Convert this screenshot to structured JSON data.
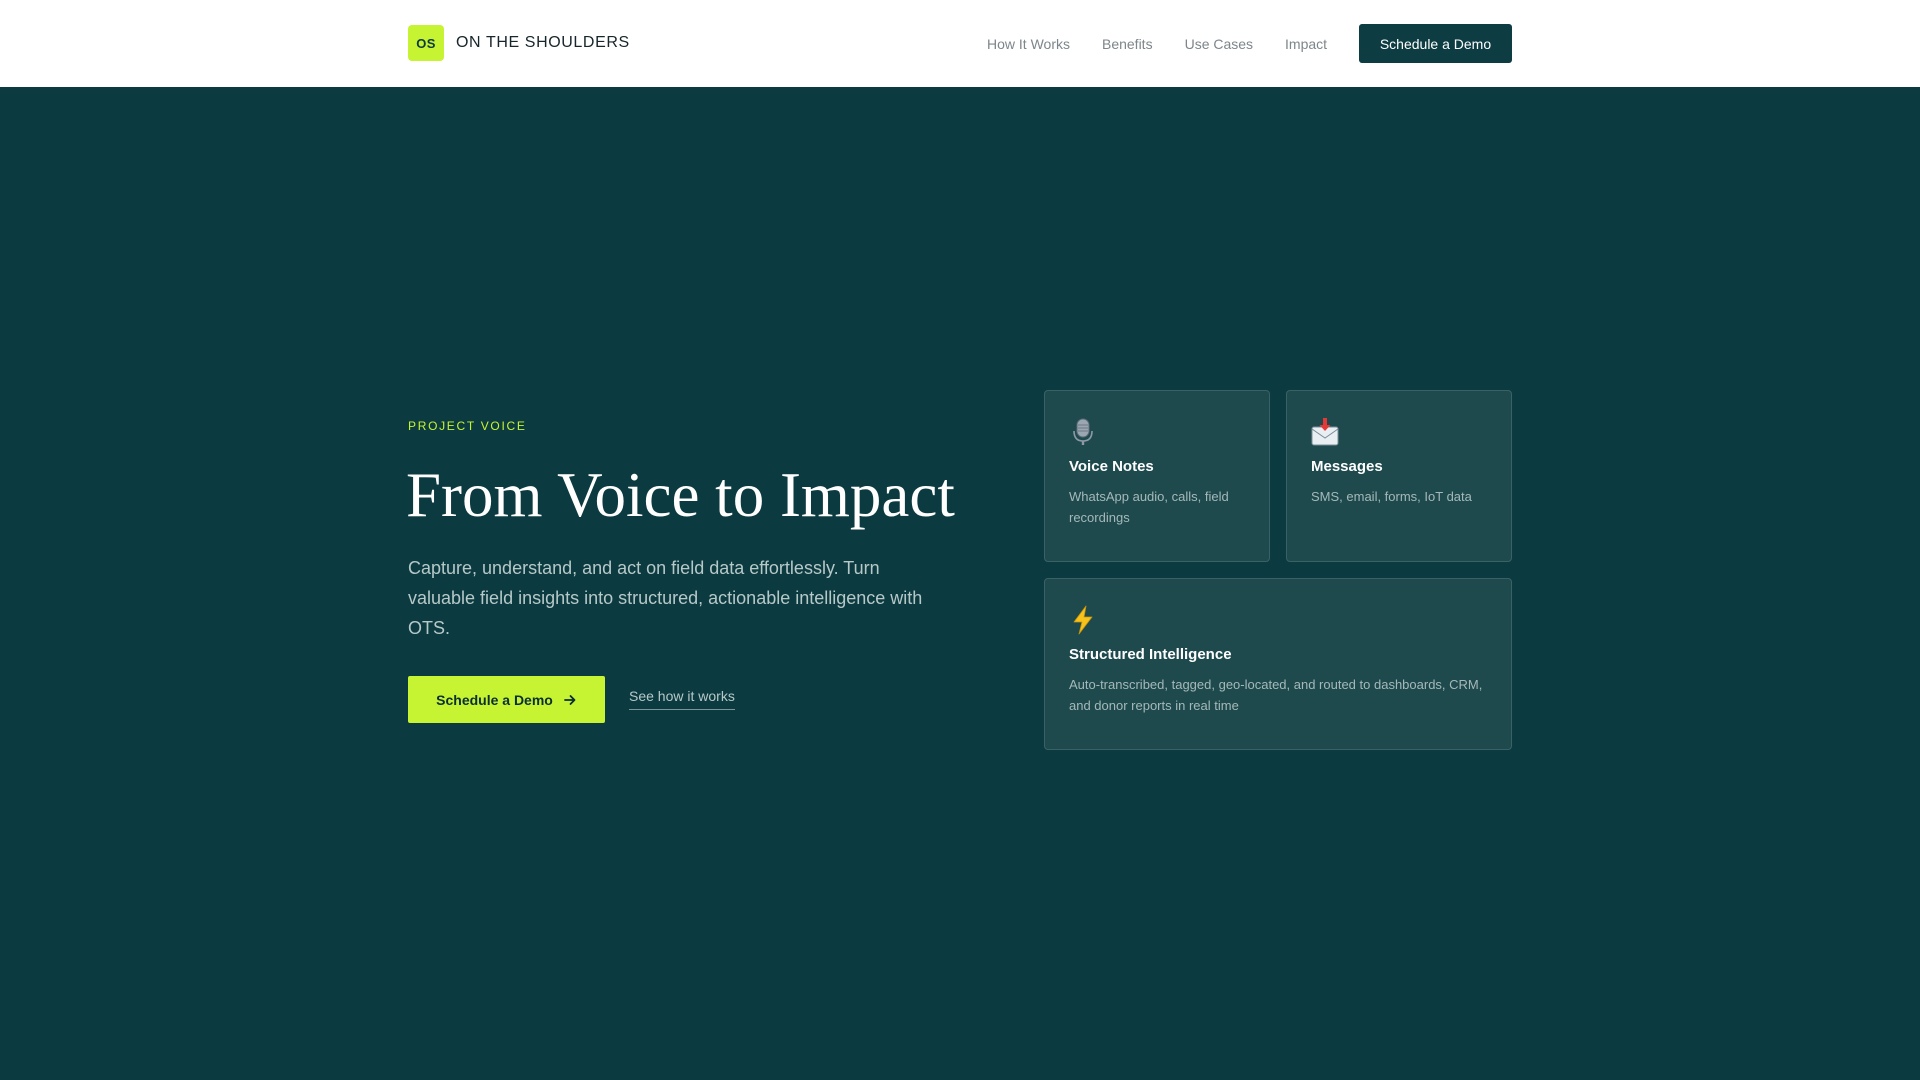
{
  "header": {
    "logo_text": "OS",
    "brand_name": "ON THE SHOULDERS",
    "nav": [
      "How It Works",
      "Benefits",
      "Use Cases",
      "Impact"
    ],
    "cta_label": "Schedule a Demo"
  },
  "hero": {
    "eyebrow": "PROJECT VOICE",
    "title": "From Voice to Impact",
    "description": "Capture, understand, and act on field data effortlessly. Turn valuable field insights into structured, actionable intelligence with OTS.",
    "primary_cta": "Schedule a Demo",
    "primary_cta_icon": "arrow-right-icon",
    "secondary_cta": "See how it works"
  },
  "cards": [
    {
      "icon": "microphone-icon",
      "title": "Voice Notes",
      "description": "WhatsApp audio, calls, field recordings"
    },
    {
      "icon": "inbox-tray-icon",
      "title": "Messages",
      "description": "SMS, email, forms, IoT data"
    },
    {
      "icon": "lightning-icon",
      "title": "Structured Intelligence",
      "description": "Auto-transcribed, tagged, geo-located, and routed to dashboards, CRM, and donor reports in real time"
    }
  ],
  "colors": {
    "background": "#0b3b40",
    "accent": "#c6f432",
    "card": "#1e4a4e",
    "header": "#ffffff"
  }
}
